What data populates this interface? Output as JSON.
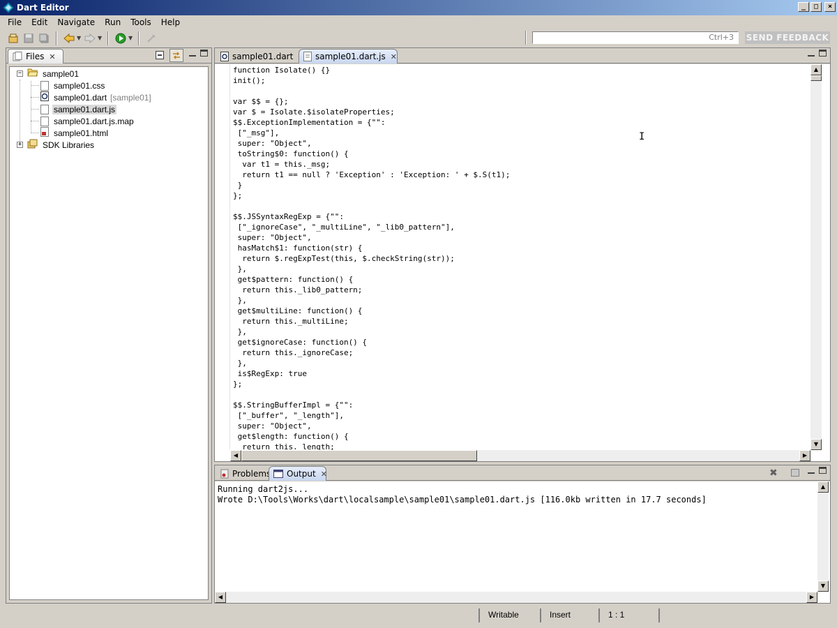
{
  "window": {
    "title": "Dart Editor",
    "controls": [
      "_",
      "□",
      "×"
    ]
  },
  "menu": [
    "File",
    "Edit",
    "Navigate",
    "Run",
    "Tools",
    "Help"
  ],
  "toolbar": {
    "search_hint": "Ctrl+3",
    "feedback_label": "SEND FEEDBACK"
  },
  "files_panel": {
    "tab_label": "Files",
    "tree": {
      "project": "sample01",
      "files": [
        {
          "name": "sample01.css",
          "suffix": "",
          "icon": "css-file-icon"
        },
        {
          "name": "sample01.dart",
          "suffix": "[sample01]",
          "icon": "dart-file-icon"
        },
        {
          "name": "sample01.dart.js",
          "suffix": "",
          "icon": "js-file-icon",
          "selected": true
        },
        {
          "name": "sample01.dart.js.map",
          "suffix": "",
          "icon": "map-file-icon"
        },
        {
          "name": "sample01.html",
          "suffix": "",
          "icon": "html-file-icon"
        }
      ],
      "libraries": "SDK Libraries"
    }
  },
  "editor": {
    "tabs": [
      {
        "label": "sample01.dart",
        "active": false
      },
      {
        "label": "sample01.dart.js",
        "active": true
      }
    ],
    "code_lines": [
      "function Isolate() {}",
      "init();",
      "",
      "var $$ = {};",
      "var $ = Isolate.$isolateProperties;",
      "$$.ExceptionImplementation = {\"\":",
      " [\"_msg\"],",
      " super: \"Object\",",
      " toString$0: function() {",
      "  var t1 = this._msg;",
      "  return t1 == null ? 'Exception' : 'Exception: ' + $.S(t1);",
      " }",
      "};",
      "",
      "$$.JSSyntaxRegExp = {\"\":",
      " [\"_ignoreCase\", \"_multiLine\", \"_lib0_pattern\"],",
      " super: \"Object\",",
      " hasMatch$1: function(str) {",
      "  return $.regExpTest(this, $.checkString(str));",
      " },",
      " get$pattern: function() {",
      "  return this._lib0_pattern;",
      " },",
      " get$multiLine: function() {",
      "  return this._multiLine;",
      " },",
      " get$ignoreCase: function() {",
      "  return this._ignoreCase;",
      " },",
      " is$RegExp: true",
      "};",
      "",
      "$$.StringBufferImpl = {\"\":",
      " [\"_buffer\", \"_length\"],",
      " super: \"Object\",",
      " get$length: function() {",
      "  return this._length;"
    ]
  },
  "bottom_panel": {
    "tabs": [
      {
        "label": "Problems",
        "active": false
      },
      {
        "label": "Output",
        "active": true
      }
    ],
    "output_lines": [
      "Running dart2js...",
      "Wrote D:\\Tools\\Works\\dart\\localsample\\sample01\\sample01.dart.js [116.0kb written in 17.7 seconds]"
    ]
  },
  "status": {
    "writable": "Writable",
    "mode": "Insert",
    "position": "1 : 1"
  }
}
